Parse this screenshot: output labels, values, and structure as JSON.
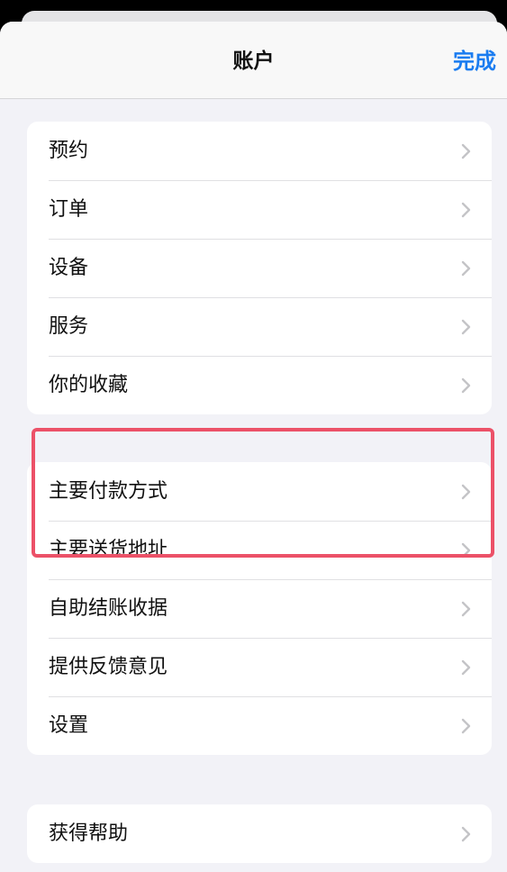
{
  "header": {
    "title": "账户",
    "done_label": "完成"
  },
  "groups": [
    {
      "items": [
        {
          "label": "预约"
        },
        {
          "label": "订单"
        },
        {
          "label": "设备"
        },
        {
          "label": "服务"
        },
        {
          "label": "你的收藏"
        }
      ]
    },
    {
      "items": [
        {
          "label": "主要付款方式"
        },
        {
          "label": "主要送货地址"
        },
        {
          "label": "自助结账收据"
        },
        {
          "label": "提供反馈意见"
        },
        {
          "label": "设置"
        }
      ]
    },
    {
      "items": [
        {
          "label": "获得帮助"
        }
      ]
    }
  ],
  "icons": {
    "row_chevron": "chevron-right-icon"
  },
  "colors": {
    "accent": "#1a7cf0",
    "highlight_border": "#ec5168",
    "background": "#f2f2f7",
    "chevron": "#c4c4c7"
  }
}
